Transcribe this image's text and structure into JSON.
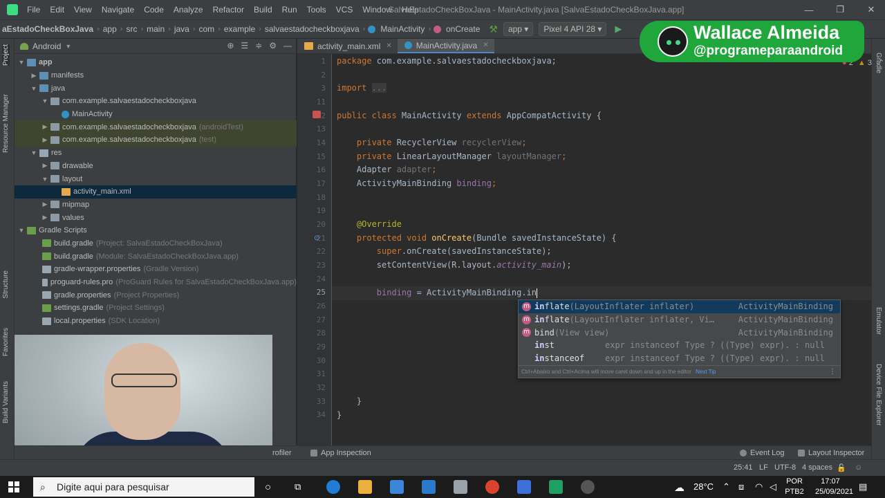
{
  "titlebar": {
    "menu": [
      "File",
      "Edit",
      "View",
      "Navigate",
      "Code",
      "Analyze",
      "Refactor",
      "Build",
      "Run",
      "Tools",
      "VCS",
      "Window",
      "Help"
    ],
    "title": "SalvaEstadoCheckBoxJava - MainActivity.java [SalvaEstadoCheckBoxJava.app]",
    "minimize": "—",
    "maximize": "❐",
    "close": "✕"
  },
  "navbar": {
    "crumbs": [
      "aEstadoCheckBoxJava",
      "app",
      "src",
      "main",
      "java",
      "com",
      "example",
      "salvaestadocheckboxjava",
      "MainActivity",
      "onCreate"
    ],
    "run_config": "app",
    "device": "Pixel 4 API 28"
  },
  "left_strip": {
    "tabs": [
      "Project",
      "Resource Manager",
      "Structure",
      "Favorites",
      "Build Variants"
    ]
  },
  "right_strip": {
    "tabs": [
      "Gradle",
      "Emulator",
      "Device File Explorer"
    ]
  },
  "project": {
    "view": "Android",
    "tree": [
      {
        "label": "app",
        "hint": "",
        "icon": "folder-blue",
        "expanded": true
      },
      {
        "label": "manifests",
        "hint": "",
        "icon": "folder-blue",
        "expanded": false
      },
      {
        "label": "java",
        "hint": "",
        "icon": "folder-blue",
        "expanded": true
      },
      {
        "label": "com.example.salvaestadocheckboxjava",
        "hint": "",
        "icon": "folder",
        "expanded": true
      },
      {
        "label": "MainActivity",
        "hint": "",
        "icon": "class",
        "expanded": null
      },
      {
        "label": "com.example.salvaestadocheckboxjava",
        "hint": "(androidTest)",
        "icon": "folder",
        "expanded": false
      },
      {
        "label": "com.example.salvaestadocheckboxjava",
        "hint": "(test)",
        "icon": "folder",
        "expanded": false
      },
      {
        "label": "res",
        "hint": "",
        "icon": "res",
        "expanded": true
      },
      {
        "label": "drawable",
        "hint": "",
        "icon": "folder",
        "expanded": false
      },
      {
        "label": "layout",
        "hint": "",
        "icon": "folder",
        "expanded": true
      },
      {
        "label": "activity_main.xml",
        "hint": "",
        "icon": "xml",
        "expanded": null
      },
      {
        "label": "mipmap",
        "hint": "",
        "icon": "folder",
        "expanded": false
      },
      {
        "label": "values",
        "hint": "",
        "icon": "folder",
        "expanded": false
      },
      {
        "label": "Gradle Scripts",
        "hint": "",
        "icon": "gradle",
        "expanded": true
      },
      {
        "label": "build.gradle",
        "hint": "(Project: SalvaEstadoCheckBoxJava)",
        "icon": "gradle",
        "expanded": null
      },
      {
        "label": "build.gradle",
        "hint": "(Module: SalvaEstadoCheckBoxJava.app)",
        "icon": "gradle",
        "expanded": null
      },
      {
        "label": "gradle-wrapper.properties",
        "hint": "(Gradle Version)",
        "icon": "props",
        "expanded": null
      },
      {
        "label": "proguard-rules.pro",
        "hint": "(ProGuard Rules for SalvaEstadoCheckBoxJava.app)",
        "icon": "props",
        "expanded": null
      },
      {
        "label": "gradle.properties",
        "hint": "(Project Properties)",
        "icon": "props",
        "expanded": null
      },
      {
        "label": "settings.gradle",
        "hint": "(Project Settings)",
        "icon": "gradle",
        "expanded": null
      },
      {
        "label": "local.properties",
        "hint": "(SDK Location)",
        "icon": "props",
        "expanded": null
      }
    ]
  },
  "editor": {
    "tabs": [
      {
        "label": "activity_main.xml",
        "active": false
      },
      {
        "label": "MainActivity.java",
        "active": true
      }
    ],
    "line_numbers": [
      "1",
      "2",
      "3",
      "11",
      "12",
      "13",
      "14",
      "15",
      "16",
      "17",
      "18",
      "19",
      "20",
      "21",
      "22",
      "23",
      "24",
      "25",
      "26",
      "27",
      "28",
      "29",
      "30",
      "31",
      "32",
      "33",
      "34"
    ],
    "current_line": "25",
    "warnings": "2",
    "weak_warnings": "3",
    "code": {
      "l1_kw": "package",
      "l1_rest": " com.example.salvaestadocheckboxjava;",
      "l3_kw": "import",
      "l3_fold": "...",
      "l12_kw": "public class",
      "l12_name": " MainActivity ",
      "l12_kw2": "extends",
      "l12_rest": " AppCompatActivity {",
      "l14_kw": "private",
      "l14_type": " RecyclerView ",
      "l14_var": "recyclerView",
      "l14_end": ";",
      "l15_kw": "private",
      "l15_type": " LinearLayoutManager ",
      "l15_var": "layoutManager",
      "l15_end": ";",
      "l16_type": "Adapter ",
      "l16_var": "adapter",
      "l16_end": ";",
      "l17_type": "ActivityMainBinding ",
      "l17_var": "binding",
      "l17_end": ";",
      "l20_ann": "@Override",
      "l21_kw": "protected void",
      "l21_fn": " onCreate",
      "l21_rest": "(Bundle savedInstanceState) {",
      "l22_kw": "super",
      "l22_rest": ".onCreate(savedInstanceState);",
      "l23_a": "setContentView(R.layout.",
      "l23_b": "activity_main",
      "l23_c": ");",
      "l25_var": "binding",
      "l25_rest": " = ActivityMainBinding.",
      "l25_typed": "in",
      "l33": "}",
      "l34": "}"
    },
    "completion": {
      "items": [
        {
          "badge": "m",
          "name": "inflate",
          "sig": "(LayoutInflater inflater)",
          "type": "ActivityMainBinding"
        },
        {
          "badge": "m",
          "name": "inflate",
          "sig": "(LayoutInflater inflater, Vi…",
          "type": "ActivityMainBinding"
        },
        {
          "badge": "m",
          "name": "bind",
          "sig": "(View view)",
          "type": "ActivityMainBinding"
        },
        {
          "badge": "",
          "name": "inst",
          "sig": "expr instanceof Type ? ((Type) expr). : null",
          "type": ""
        },
        {
          "badge": "",
          "name": "instanceof",
          "sig": "expr instanceof Type ? ((Type) expr). : null",
          "type": ""
        }
      ],
      "footer": "Ctrl+Abaixo and Ctrl+Acima will move caret down and up in the editor",
      "next_tip": "Next Tip",
      "more": "⋮"
    }
  },
  "bottom_tools": {
    "profiler": "rofiler",
    "app_inspection": "App Inspection",
    "event_log": "Event Log",
    "layout_inspector": "Layout Inspector"
  },
  "status": {
    "position": "25:41",
    "line_sep": "LF",
    "encoding": "UTF-8",
    "indent": "4 spaces"
  },
  "brand": {
    "name": "Wallace Almeida",
    "handle": "@programeparaandroid"
  },
  "taskbar": {
    "search_placeholder": "Digite aqui para pesquisar",
    "weather": "28°C",
    "lang1": "POR",
    "lang2": "PTB2",
    "time": "17:07",
    "date": "25/09/2021"
  },
  "colors": {
    "accent": "#4a88c7",
    "brand_green": "#1fa73b",
    "keyword": "#cc7832",
    "annotation": "#bbb529",
    "field": "#9876aa"
  }
}
